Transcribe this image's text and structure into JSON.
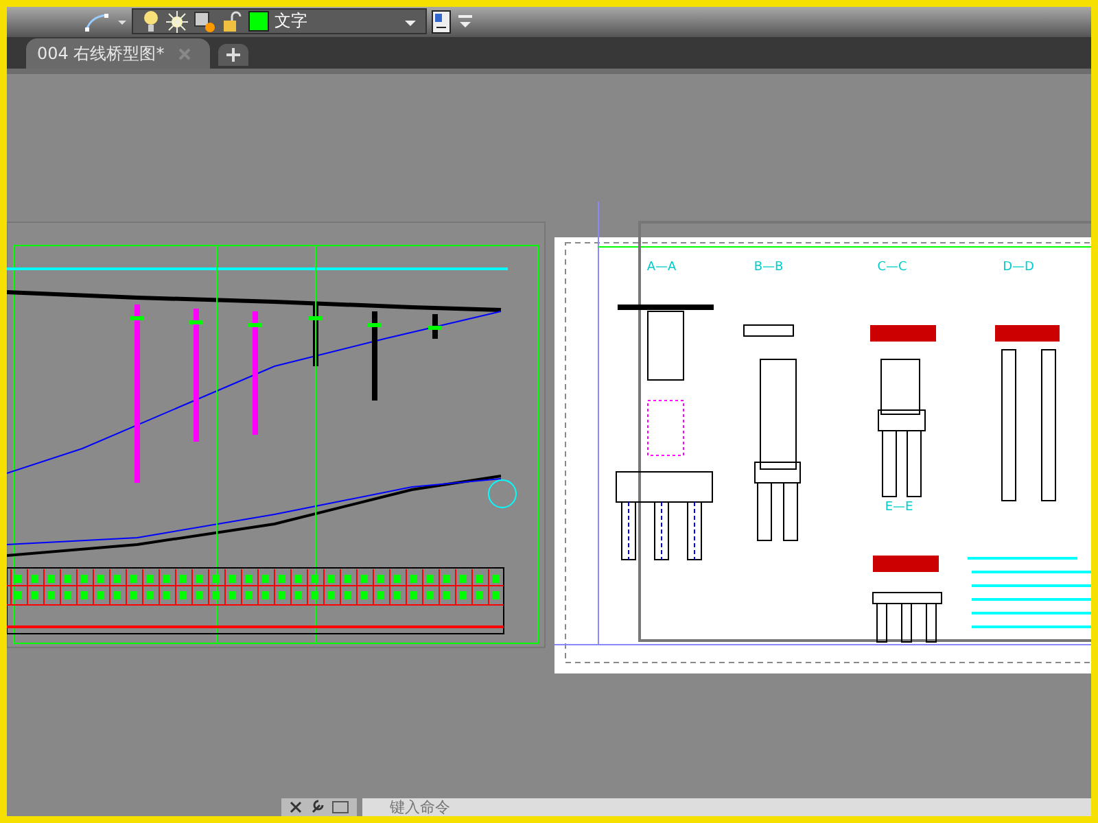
{
  "toolbar": {
    "layer_name": "文字"
  },
  "tabs": [
    {
      "label": "004 右线桥型图*",
      "selected": true
    }
  ],
  "drawing": {
    "section_labels": [
      "A—A",
      "B—B",
      "C—C",
      "D—D",
      "E—E"
    ]
  },
  "command_line": {
    "placeholder": "键入命令"
  }
}
